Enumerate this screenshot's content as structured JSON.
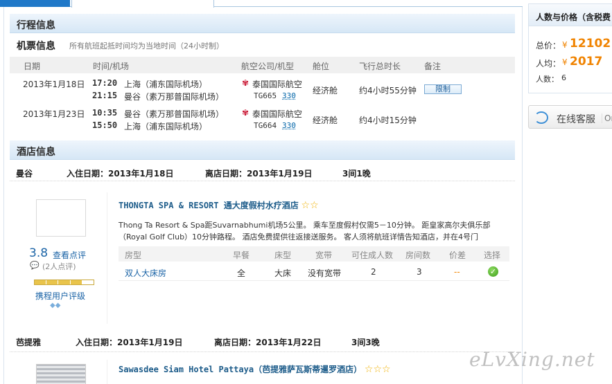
{
  "tabs": {
    "first": "",
    "second": ""
  },
  "itinerary": {
    "title": "行程信息",
    "flights_title": "机票信息",
    "flights_note": "所有航班起抵时间均为当地时间（24小时制）",
    "columns": [
      "日期",
      "时间/机场",
      "航空公司/机型",
      "舱位",
      "飞行总时长",
      "备注"
    ],
    "flights": [
      {
        "date": "2013年1月18日",
        "dep_time": "17:20",
        "dep_airport": "上海（浦东国际机场）",
        "arr_time": "21:15",
        "arr_airport": "曼谷（素万那普国际机场）",
        "airline": "泰国国际航空",
        "flight_no": "TG665",
        "aircraft": "330",
        "cabin": "经济舱",
        "duration": "约4小时55分钟",
        "remark": "限制"
      },
      {
        "date": "2013年1月23日",
        "dep_time": "10:35",
        "dep_airport": "曼谷（素万那普国际机场）",
        "arr_time": "15:50",
        "arr_airport": "上海（浦东国际机场）",
        "airline": "泰国国际航空",
        "flight_no": "TG664",
        "aircraft": "330",
        "cabin": "经济舱",
        "duration": "约4小时15分钟",
        "remark": ""
      }
    ]
  },
  "hotels": {
    "title": "酒店信息",
    "stay1": {
      "city": "曼谷",
      "checkin": "入住日期：2013年1月18日",
      "checkout": "离店日期：2013年1月19日",
      "nights": "3间1晚",
      "name": "THONGTA SPA & RESORT 通大度假村水疗酒店",
      "stars": "☆☆",
      "desc_line1": "Thong Ta Resort & Spa距Suvarnabhumi机场5公里。 乘车至度假村仅需5－10分钟。 距皇家高尔夫俱乐部",
      "desc_line2": "（Royal Golf Club）10分钟路程。 酒店免费提供往返接送服务。 客人须将航班详情告知酒店，并在4号门",
      "score": "3.8",
      "review_link": "查看点评",
      "review_count": "(2人点评)",
      "rating_label": "携程用户评级",
      "room_columns": [
        "房型",
        "早餐",
        "床型",
        "宽带",
        "可住成人数",
        "房间数",
        "价差",
        "选择"
      ],
      "room": {
        "type": "双人大床房",
        "breakfast": "全",
        "bed": "大床",
        "broadband": "没有宽带",
        "adults": "2",
        "rooms": "3",
        "price_diff": "--"
      }
    },
    "stay2": {
      "city": "芭提雅",
      "checkin": "入住日期：2013年1月19日",
      "checkout": "离店日期：2013年1月22日",
      "nights": "3间3晚",
      "name": "Sawasdee Siam Hotel Pattaya（芭提雅萨瓦斯蒂暹罗酒店）",
      "stars": "☆☆☆"
    }
  },
  "summary": {
    "title": "人数与价格（含税费",
    "total_label": "总价：",
    "total_value": "12102",
    "per_label": "人均：",
    "per_value": "2017",
    "count_label": "人数：",
    "count_value": "6",
    "currency": "¥"
  },
  "service": {
    "label": "在线客服",
    "extra": "On"
  },
  "watermark": "eLvXing.net",
  "colors": {
    "accent": "#1f78c8",
    "price": "#f08300",
    "link": "#1a63a6"
  }
}
